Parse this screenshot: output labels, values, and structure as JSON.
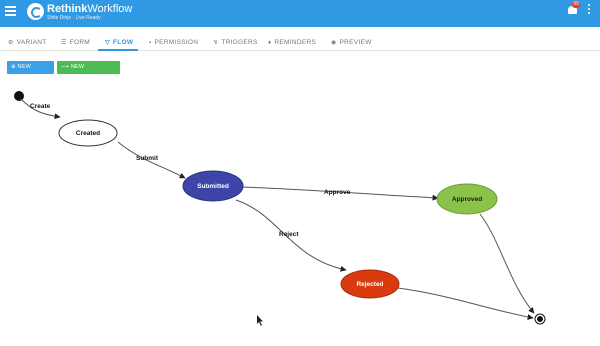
{
  "header": {
    "brand_bold": "Rethink",
    "brand_rest": "Workflow",
    "tagline": "Shite Dinje · Live Ready",
    "notification_count": "99",
    "background_color": "#2f9ae3"
  },
  "tabs": [
    {
      "label": "VARIANT",
      "icon": "gear-icon",
      "active": false
    },
    {
      "label": "FORM",
      "icon": "list-icon",
      "active": false
    },
    {
      "label": "FLOW",
      "icon": "filter-icon",
      "active": true
    },
    {
      "label": "PERMISSION",
      "icon": "lock-icon",
      "active": false
    },
    {
      "label": "TRIGGERS",
      "icon": "bolt-icon",
      "active": false
    },
    {
      "label": "REMINDERS",
      "icon": "bell-icon",
      "active": false
    },
    {
      "label": "PREVIEW",
      "icon": "eye-icon",
      "active": false
    }
  ],
  "toolbar": {
    "new_state": "NEW STATE",
    "new_transition": "NEW TRANSITION"
  },
  "flow": {
    "states": {
      "created": {
        "label": "Created",
        "color": "#ffffff"
      },
      "submitted": {
        "label": "Submitted",
        "color": "#3c45a8"
      },
      "approved": {
        "label": "Approved",
        "color": "#8bc34a"
      },
      "rejected": {
        "label": "Rejected",
        "color": "#d93a10"
      }
    },
    "transitions": {
      "create": "Create",
      "submit": "Submit",
      "approve": "Approve",
      "reject": "Reject"
    }
  }
}
